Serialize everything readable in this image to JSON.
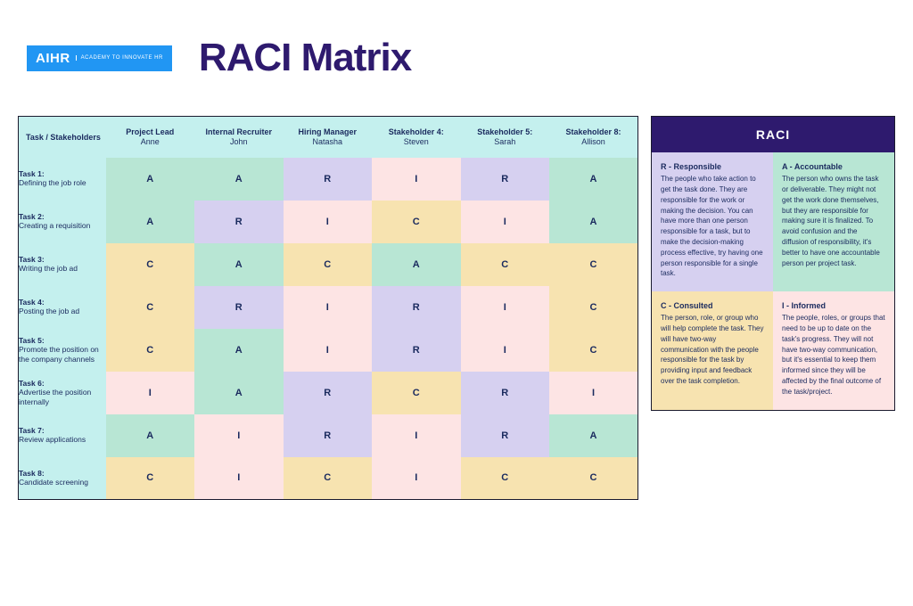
{
  "logo": {
    "brand": "AIHR",
    "tagline": "ACADEMY TO INNOVATE HR"
  },
  "title": "RACI Matrix",
  "matrix": {
    "corner": "Task / Stakeholders",
    "stakeholders": [
      {
        "role": "Project Lead",
        "name": "Anne"
      },
      {
        "role": "Internal Recruiter",
        "name": "John"
      },
      {
        "role": "Hiring Manager",
        "name": "Natasha"
      },
      {
        "role": "Stakeholder 4:",
        "name": "Steven"
      },
      {
        "role": "Stakeholder 5:",
        "name": "Sarah"
      },
      {
        "role": "Stakeholder 8:",
        "name": "Allison"
      }
    ],
    "tasks": [
      {
        "num": "Task 1:",
        "desc": "Defining the job role",
        "vals": [
          "A",
          "A",
          "R",
          "I",
          "R",
          "A"
        ]
      },
      {
        "num": "Task 2:",
        "desc": "Creating a requisition",
        "vals": [
          "A",
          "R",
          "I",
          "C",
          "I",
          "A"
        ]
      },
      {
        "num": "Task 3:",
        "desc": "Writing the job ad",
        "vals": [
          "C",
          "A",
          "C",
          "A",
          "C",
          "C"
        ]
      },
      {
        "num": "Task 4:",
        "desc": "Posting the job ad",
        "vals": [
          "C",
          "R",
          "I",
          "R",
          "I",
          "C"
        ]
      },
      {
        "num": "Task 5:",
        "desc": "Promote the position on the company channels",
        "vals": [
          "C",
          "A",
          "I",
          "R",
          "I",
          "C"
        ]
      },
      {
        "num": "Task 6:",
        "desc": "Advertise the position internally",
        "vals": [
          "I",
          "A",
          "R",
          "C",
          "R",
          "I"
        ]
      },
      {
        "num": "Task 7:",
        "desc": "Review applications",
        "vals": [
          "A",
          "I",
          "R",
          "I",
          "R",
          "A"
        ]
      },
      {
        "num": "Task 8:",
        "desc": "Candidate screening",
        "vals": [
          "C",
          "I",
          "C",
          "I",
          "C",
          "C"
        ]
      }
    ]
  },
  "legend": {
    "header": "RACI",
    "items": {
      "R": {
        "title": "R - Responsible",
        "desc": "The people who take action to get the task done. They are responsible for the work or making the decision. You can have more than one person responsible for a task, but to make the decision-making process effective, try having one person responsible for a single task."
      },
      "A": {
        "title": "A - Accountable",
        "desc": "The person who owns the task or deliverable. They might not get the work done themselves, but they are responsible for making sure it is finalized. To avoid confusion and the diffusion of responsibility, it's better to have one accountable person per project task."
      },
      "C": {
        "title": "C - Consulted",
        "desc": "The person, role, or group who will help complete the task. They will have two-way communication with the people responsible for the task by providing input and feedback over the task completion."
      },
      "I": {
        "title": "I - Informed",
        "desc": "The people, roles, or groups that need to be up to date on the task's progress. They will not have two-way communication, but it's essential to keep them informed since they will be affected by the final outcome of the task/project."
      }
    }
  }
}
